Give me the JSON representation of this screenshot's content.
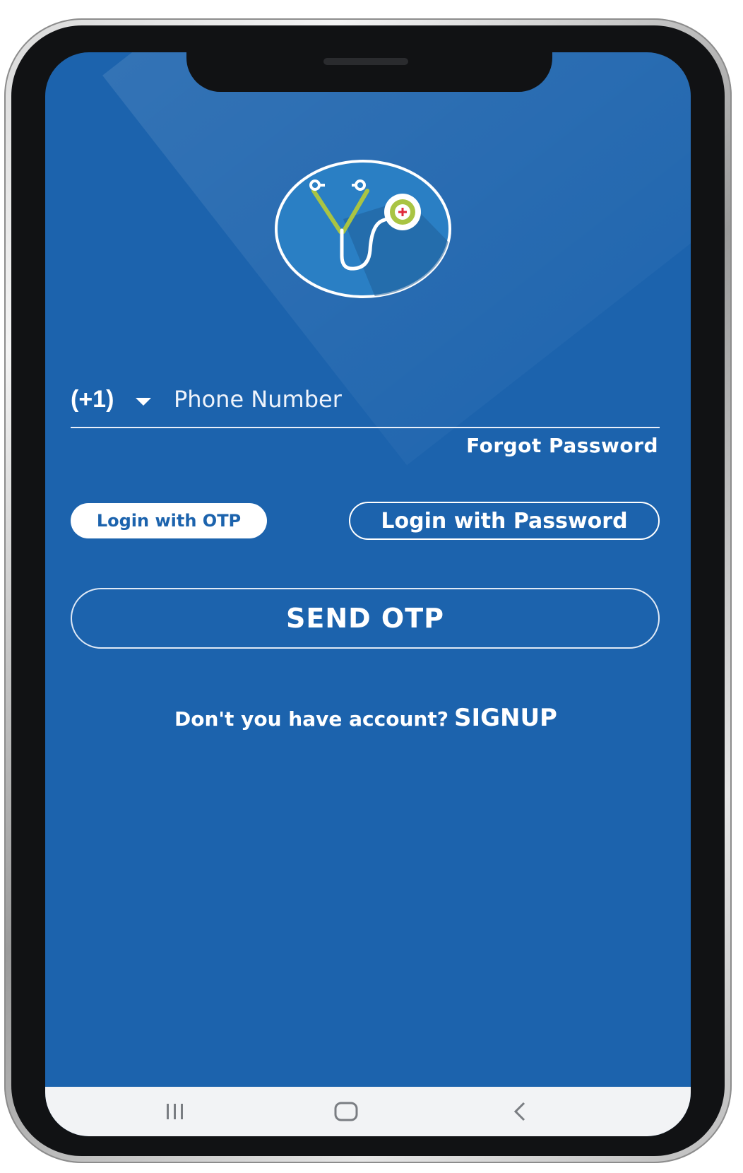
{
  "login": {
    "country_code": "(+1)",
    "phone_placeholder": "Phone Number",
    "forgot_password": "Forgot Password",
    "otp_tab": "Login with OTP",
    "password_tab": "Login with Password",
    "send_button": "SEND OTP",
    "signup_prompt": "Don't you have account?",
    "signup_link": "SIGNUP"
  },
  "nav": {
    "recent_icon": "recent-apps-icon",
    "home_icon": "home-icon",
    "back_icon": "back-icon"
  },
  "colors": {
    "screen_background": "#1c63ad",
    "accent_green": "#a9c443",
    "accent_red": "#e0293a",
    "nav_background": "#f2f3f5"
  }
}
